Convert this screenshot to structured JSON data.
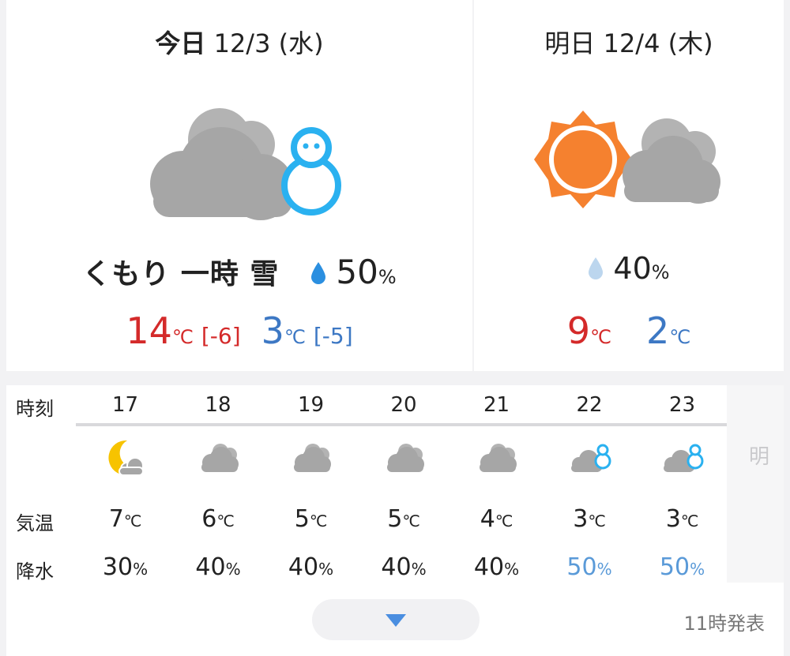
{
  "today": {
    "title_bold": "今日",
    "title_date": " 12/3 (水)",
    "condition": "くもり 一時 雪",
    "icon": "cloud-snowman-icon",
    "rain_chance": "50",
    "rain_unit": "%",
    "high": "14",
    "high_diff": "[-6]",
    "low": "3",
    "low_diff": "[-5]",
    "temp_unit": "℃"
  },
  "tomorrow": {
    "title": "明日 12/4 (木)",
    "icon": "sun-cloud-icon",
    "rain_chance": "40",
    "rain_unit": "%",
    "high": "9",
    "low": "2",
    "temp_unit": "℃"
  },
  "hourly": {
    "labels": {
      "time": "時刻",
      "temp": "気温",
      "rain": "降水"
    },
    "next_label": "明",
    "temp_unit": "℃",
    "rain_unit": "%",
    "hours": [
      {
        "hour": "17",
        "icon": "moon-cloud-icon",
        "temp": "7",
        "rain": "30"
      },
      {
        "hour": "18",
        "icon": "cloud-icon",
        "temp": "6",
        "rain": "40"
      },
      {
        "hour": "19",
        "icon": "cloud-icon",
        "temp": "5",
        "rain": "40"
      },
      {
        "hour": "20",
        "icon": "cloud-icon",
        "temp": "5",
        "rain": "40"
      },
      {
        "hour": "21",
        "icon": "cloud-icon",
        "temp": "4",
        "rain": "40"
      },
      {
        "hour": "22",
        "icon": "cloud-snowman-icon",
        "temp": "3",
        "rain": "50"
      },
      {
        "hour": "23",
        "icon": "cloud-snowman-icon",
        "temp": "3",
        "rain": "50"
      }
    ]
  },
  "footer": {
    "issued": "11時発表",
    "expand_icon": "chevron-down-icon"
  },
  "colors": {
    "high": "#d42a2a",
    "low": "#3d78c4",
    "snow_rain": "#5a9ad8",
    "sun": "#f5812f",
    "cloud": "#a6a6a6",
    "accent": "#4a8ee0"
  }
}
